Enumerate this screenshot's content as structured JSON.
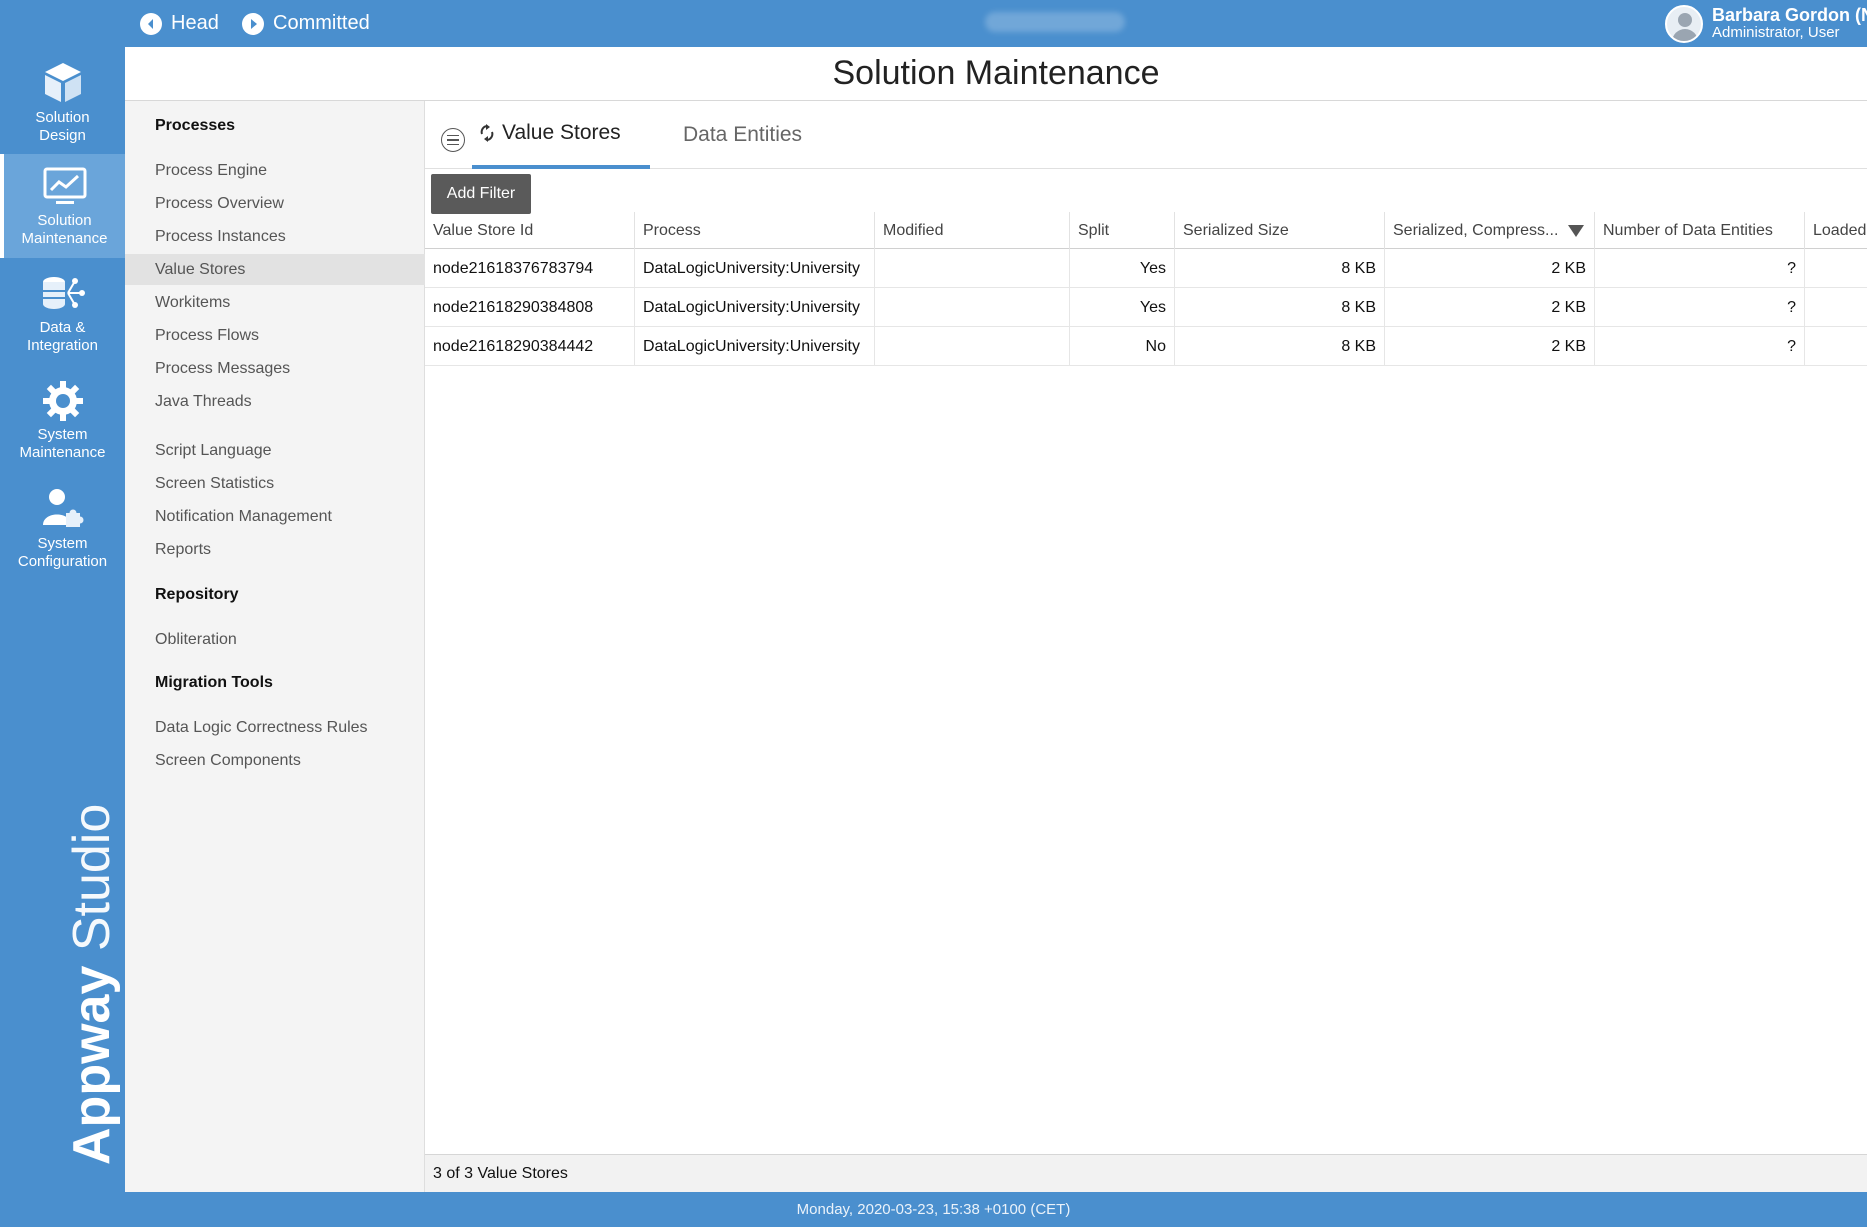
{
  "topbar": {
    "head_label": "Head",
    "committed_label": "Committed",
    "user_name": "Barbara Gordon (NE",
    "user_role": "Administrator, User"
  },
  "rail": {
    "items": [
      {
        "label_1": "Solution",
        "label_2": "Design",
        "icon": "cube-icon"
      },
      {
        "label_1": "Solution",
        "label_2": "Maintenance",
        "icon": "chart-monitor-icon"
      },
      {
        "label_1": "Data &",
        "label_2": "Integration",
        "icon": "database-network-icon"
      },
      {
        "label_1": "System",
        "label_2": "Maintenance",
        "icon": "gear-icon"
      },
      {
        "label_1": "System",
        "label_2": "Configuration",
        "icon": "user-puzzle-icon"
      }
    ],
    "brand_1": "Appway",
    "brand_2": "Studio"
  },
  "page": {
    "title": "Solution Maintenance"
  },
  "sidebar": {
    "processes_title": "Processes",
    "process_items": [
      "Process Engine",
      "Process Overview",
      "Process Instances",
      "Value Stores",
      "Workitems",
      "Process Flows",
      "Process Messages",
      "Java Threads"
    ],
    "other_items": [
      "Script Language",
      "Screen Statistics",
      "Notification Management",
      "Reports"
    ],
    "repository_title": "Repository",
    "repository_items": [
      "Obliteration"
    ],
    "migration_title": "Migration Tools",
    "migration_items": [
      "Data Logic Correctness Rules",
      "Screen Components"
    ]
  },
  "tabs": {
    "value_stores": "Value Stores",
    "data_entities": "Data Entities"
  },
  "toolbar": {
    "add_filter": "Add Filter"
  },
  "table": {
    "columns": [
      "Value Store Id",
      "Process",
      "Modified",
      "Split",
      "Serialized Size",
      "Serialized, Compress...",
      "Number of Data Entities",
      "Loaded"
    ],
    "rows": [
      [
        "node21618376783794",
        "DataLogicUniversity:University",
        "",
        "Yes",
        "8 KB",
        "2 KB",
        "?",
        ""
      ],
      [
        "node21618290384808",
        "DataLogicUniversity:University",
        "",
        "Yes",
        "8 KB",
        "2 KB",
        "?",
        ""
      ],
      [
        "node21618290384442",
        "DataLogicUniversity:University",
        "",
        "No",
        "8 KB",
        "2 KB",
        "?",
        ""
      ]
    ],
    "footer": "3 of 3 Value Stores"
  },
  "status": {
    "text": "Monday, 2020-03-23, 15:38 +0100 (CET)"
  }
}
